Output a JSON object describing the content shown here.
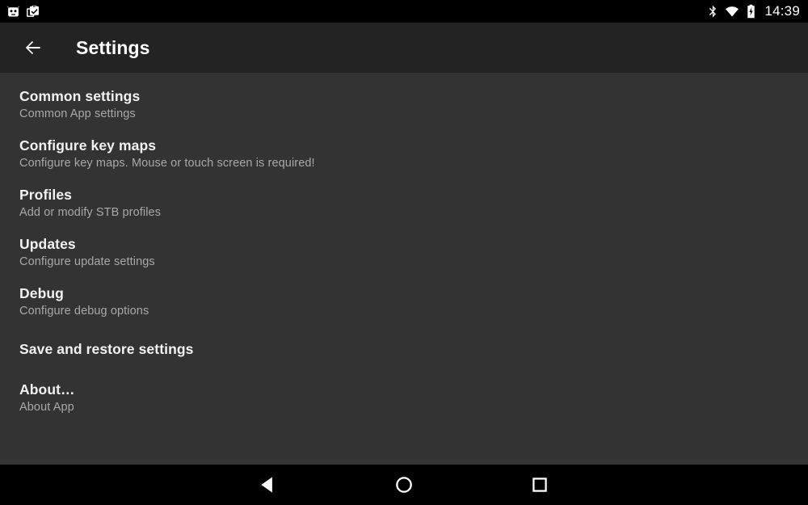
{
  "status_bar": {
    "left_icons": [
      {
        "name": "robot-face-icon",
        "label": "Android robot notification"
      },
      {
        "name": "clipboard-check-icon",
        "label": "Clipboard notification"
      }
    ],
    "right_icons": [
      {
        "name": "bluetooth-icon",
        "label": "Bluetooth on"
      },
      {
        "name": "wifi-icon",
        "label": "Wi-Fi connected"
      },
      {
        "name": "battery-charging-icon",
        "label": "Battery charging"
      }
    ],
    "clock": "14:39"
  },
  "toolbar": {
    "back_label": "Back",
    "title": "Settings"
  },
  "settings": {
    "items": [
      {
        "title": "Common settings",
        "summary": "Common App settings"
      },
      {
        "title": "Configure key maps",
        "summary": "Configure key maps. Mouse or touch screen is required!"
      },
      {
        "title": "Profiles",
        "summary": "Add or modify STB profiles"
      },
      {
        "title": "Updates",
        "summary": "Configure update settings"
      },
      {
        "title": "Debug",
        "summary": "Configure debug options"
      },
      {
        "title": "Save and restore settings",
        "summary": ""
      },
      {
        "title": "About…",
        "summary": "About App"
      }
    ]
  },
  "nav_bar": {
    "buttons": [
      {
        "name": "nav-back-button",
        "label": "Back"
      },
      {
        "name": "nav-home-button",
        "label": "Home"
      },
      {
        "name": "nav-recents-button",
        "label": "Recent apps"
      }
    ]
  },
  "colors": {
    "status_bar_bg": "#000000",
    "toolbar_bg": "#232323",
    "content_bg": "#333333",
    "nav_bar_bg": "#000000",
    "title_text": "#f2f2f2",
    "summary_text": "#a8a8a8"
  }
}
